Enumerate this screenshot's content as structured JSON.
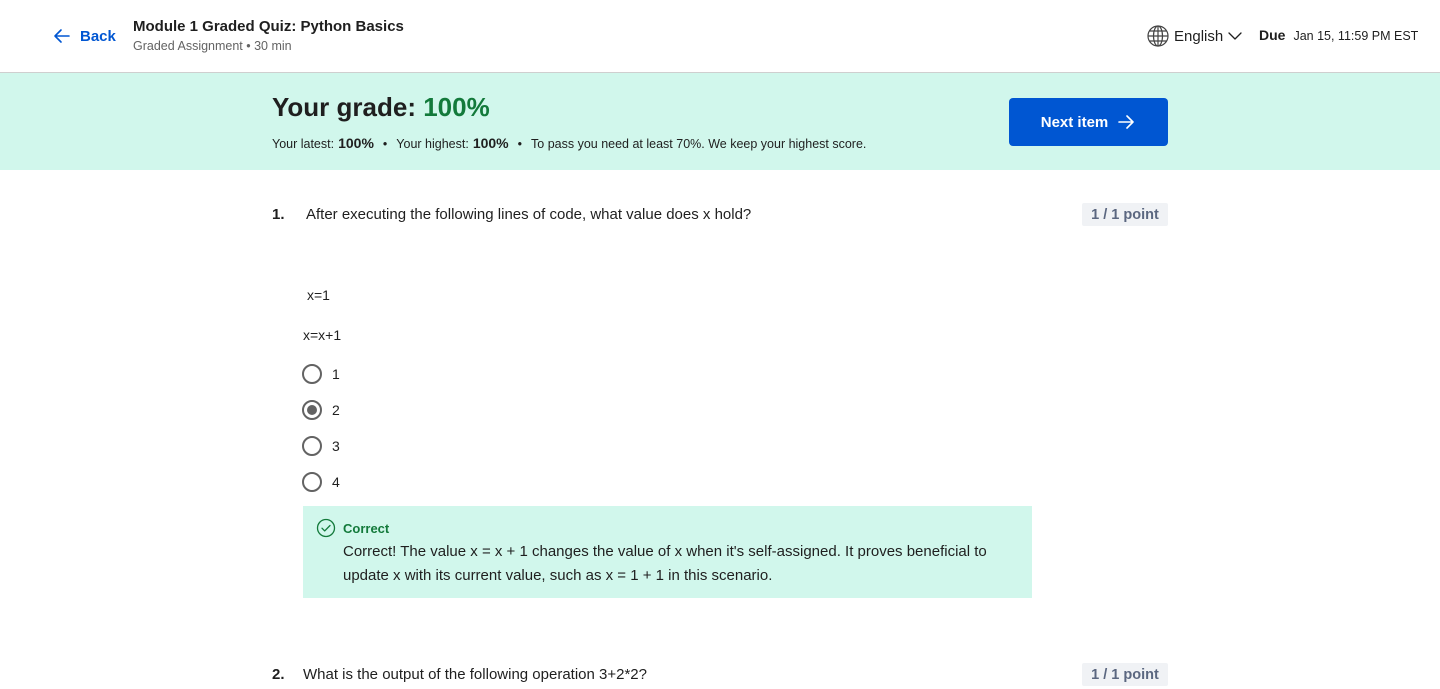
{
  "header": {
    "back_label": "Back",
    "title": "Module 1 Graded Quiz: Python Basics",
    "subtitle": "Graded Assignment • 30 min",
    "language": "English",
    "due_label": "Due",
    "due_date": "Jan 15, 11:59 PM EST"
  },
  "banner": {
    "grade_label": "Your grade:",
    "grade_value": "100%",
    "latest_label": "Your latest:",
    "latest_value": "100%",
    "highest_label": "Your highest:",
    "highest_value": "100%",
    "separator": "•",
    "pass_note": "To pass you need at least 70%. We keep your highest score.",
    "next_label": "Next item"
  },
  "questions": [
    {
      "number": "1.",
      "text": "After executing the following lines of code, what value does x hold?",
      "points": "1 / 1 point",
      "code": [
        "x=1",
        "x=x+1"
      ],
      "options": [
        {
          "label": "1",
          "selected": false
        },
        {
          "label": "2",
          "selected": true
        },
        {
          "label": "3",
          "selected": false
        },
        {
          "label": "4",
          "selected": false
        }
      ],
      "feedback": {
        "title": "Correct",
        "text": "Correct! The value x = x + 1 changes the value of x when it's self-assigned. It proves beneficial to update x with its current value, such as x = 1 + 1 in this scenario."
      }
    },
    {
      "number": "2.",
      "text": "What is the output of the following operation 3+2*2?",
      "points": "1 / 1 point"
    }
  ],
  "colors": {
    "accent": "#0056d2",
    "success_bg": "#d1f7ec",
    "success_text": "#137a3b"
  },
  "icons": [
    "arrow-left-icon",
    "globe-icon",
    "chevron-down-icon",
    "arrow-right-icon",
    "check-circle-icon"
  ]
}
